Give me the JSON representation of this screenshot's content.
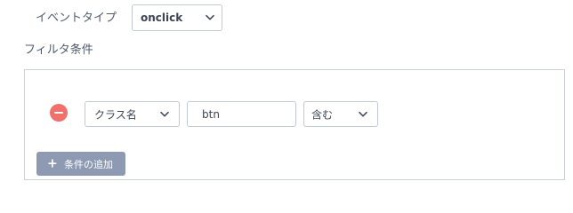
{
  "event": {
    "label": "イベントタイプ",
    "selected": "onclick",
    "icon": "chevron-down-icon"
  },
  "filter": {
    "label": "フィルタ条件",
    "rows": [
      {
        "field": "クラス名",
        "value": "btn",
        "operator": "含む"
      }
    ],
    "add_button_label": "条件の追加",
    "add_button_icon": "plus-icon",
    "remove_icon": "minus-icon"
  },
  "colors": {
    "remove": "#f0706b",
    "add_button": "#8e9ab2",
    "border": "#c3c8d7"
  }
}
